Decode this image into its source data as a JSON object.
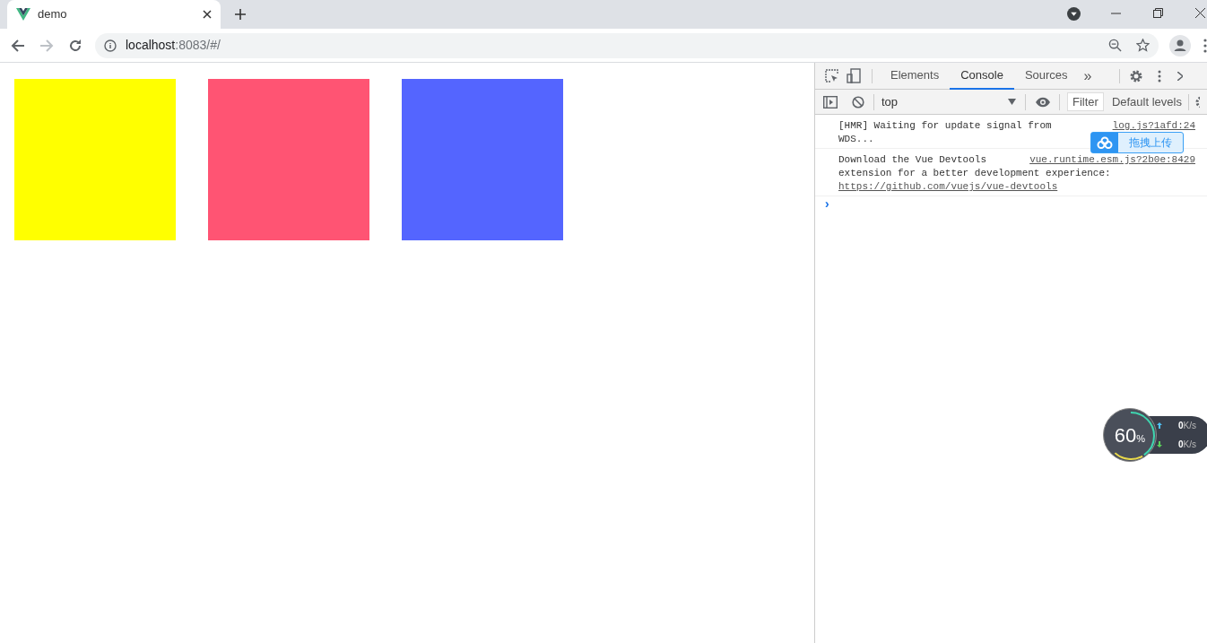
{
  "browser": {
    "tab_title": "demo",
    "url_host": "localhost",
    "url_rest": ":8083/#/"
  },
  "page": {
    "squares": [
      {
        "color": "#ffff00"
      },
      {
        "color": "#ff5473"
      },
      {
        "color": "#5465ff"
      }
    ]
  },
  "devtools": {
    "tabs": [
      {
        "label": "Elements",
        "selected": false
      },
      {
        "label": "Console",
        "selected": true
      },
      {
        "label": "Sources",
        "selected": false
      }
    ],
    "more": "»",
    "context": "top",
    "filter": "Filter",
    "levels": "Default levels",
    "messages": [
      {
        "lines": [
          "[HMR] Waiting for update signal from",
          "WDS..."
        ],
        "source": "log.js?1afd:24"
      },
      {
        "lines": [
          "Download the Vue Devtools",
          "extension for a better development experience:"
        ],
        "link": "https://github.com/vuejs/vue-devtools",
        "source": "vue.runtime.esm.js?2b0e:8429"
      }
    ],
    "prompt": "›"
  },
  "upload_badge": {
    "label": "拖拽上传"
  },
  "monitor": {
    "percent": "60",
    "unit": "%",
    "up": "0",
    "up_unit": "K/s",
    "down": "0",
    "down_unit": "K/s"
  }
}
